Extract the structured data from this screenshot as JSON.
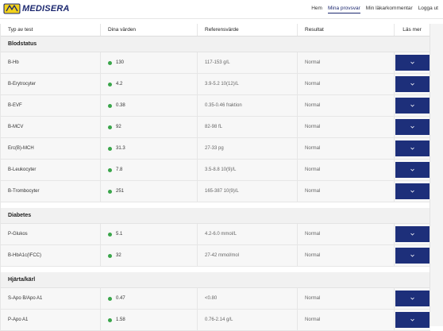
{
  "brand": {
    "name": "MEDISERA"
  },
  "nav": [
    {
      "label": "Hem",
      "active": false
    },
    {
      "label": "Mina provsvar",
      "active": true
    },
    {
      "label": "Min läkarkommentar",
      "active": false
    },
    {
      "label": "Logga ut",
      "active": false
    }
  ],
  "table": {
    "headers": [
      "Typ av test",
      "Dina värden",
      "Referensvärde",
      "Resultat",
      "Läs mer"
    ],
    "status_color": "#3aa54a",
    "button_color": "#1d2f7a",
    "sections": [
      {
        "title": "Blodstatus",
        "rows": [
          {
            "test": "B-Hb",
            "value": "130",
            "ref": "117-153 g/L",
            "result": "Normal"
          },
          {
            "test": "B-Erytrocyter",
            "value": "4.2",
            "ref": "3.9-5.2 10(12)/L",
            "result": "Normal"
          },
          {
            "test": "B-EVF",
            "value": "0.38",
            "ref": "0.35-0.46 fraktion",
            "result": "Normal"
          },
          {
            "test": "B-MCV",
            "value": "92",
            "ref": "82-98 fL",
            "result": "Normal"
          },
          {
            "test": "Erc(B)-MCH",
            "value": "31.3",
            "ref": "27-33 pg",
            "result": "Normal"
          },
          {
            "test": "B-Leukocyter",
            "value": "7.8",
            "ref": "3.5-8.8 10(9)/L",
            "result": "Normal"
          },
          {
            "test": "B-Trombocyter",
            "value": "251",
            "ref": "165-387 10(9)/L",
            "result": "Normal"
          }
        ]
      },
      {
        "title": "Diabetes",
        "rows": [
          {
            "test": "P-Glukos",
            "value": "5.1",
            "ref": "4.2-6.0 mmol/L",
            "result": "Normal"
          },
          {
            "test": "B-HbA1c(IFCC)",
            "value": "32",
            "ref": "27-42 mmol/mol",
            "result": "Normal"
          }
        ]
      },
      {
        "title": "Hjärta/kärl",
        "rows": [
          {
            "test": "S-Apo B/Apo A1",
            "value": "0.47",
            "ref": "<0.80",
            "result": "Normal"
          },
          {
            "test": "P-Apo A1",
            "value": "1.58",
            "ref": "0.76-2.14 g/L",
            "result": "Normal"
          }
        ]
      }
    ]
  }
}
